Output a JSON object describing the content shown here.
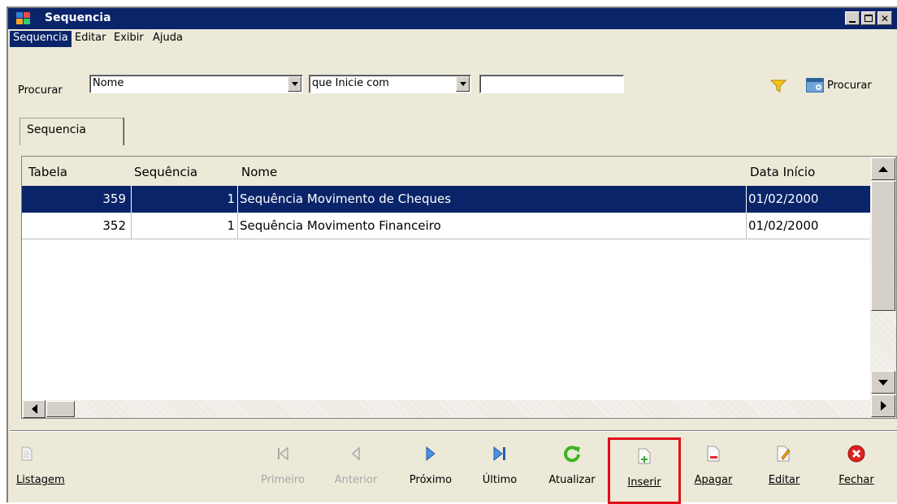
{
  "window": {
    "title": "Sequencia"
  },
  "menu": [
    "Sequencia",
    "Editar",
    "Exibir",
    "Ajuda"
  ],
  "search": {
    "label": "Procurar",
    "field_value": "Nome",
    "condition_value": "que Inicie com",
    "text_value": "",
    "button_label": "Procurar"
  },
  "tab": {
    "label": "Sequencia"
  },
  "table": {
    "columns": [
      "Tabela",
      "Sequência",
      "Nome",
      "Data Início"
    ],
    "rows": [
      {
        "tabela": "359",
        "sequencia": "1",
        "nome": "Sequência Movimento de Cheques",
        "data": "01/02/2000"
      },
      {
        "tabela": "352",
        "sequencia": "1",
        "nome": "Sequência Movimento Financeiro",
        "data": "01/02/2000"
      }
    ],
    "selected_row": 0
  },
  "toolbar": {
    "listagem": {
      "label": "Listagem",
      "icon": "document-icon"
    },
    "primeiro": {
      "label": "Primeiro",
      "icon": "first-icon"
    },
    "anterior": {
      "label": "Anterior",
      "icon": "previous-icon"
    },
    "proximo": {
      "label": "Próximo",
      "icon": "next-icon"
    },
    "ultimo": {
      "label": "Último",
      "icon": "last-icon"
    },
    "atualizar": {
      "label": "Atualizar",
      "icon": "refresh-icon"
    },
    "inserir": {
      "label": "Inserir",
      "icon": "new-document-icon"
    },
    "apagar": {
      "label": "Apagar",
      "icon": "delete-document-icon"
    },
    "editar": {
      "label": "Editar",
      "icon": "edit-document-icon"
    },
    "fechar": {
      "label": "Fechar",
      "icon": "close-icon"
    }
  },
  "colors": {
    "titlebar": "#0a246a",
    "selection": "#0a246a",
    "highlight_border": "#e0101a",
    "face": "#ece9d8"
  }
}
